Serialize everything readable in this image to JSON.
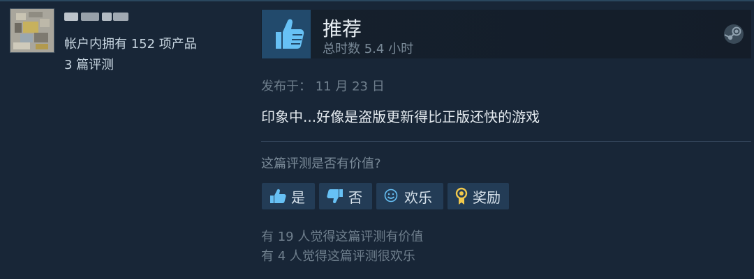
{
  "author": {
    "name_obscured": "",
    "products_owned": "帐户内拥有 152 项产品",
    "reviews_count": "3 篇评测"
  },
  "review": {
    "verdict": "推荐",
    "hours": "总时数 5.4 小时",
    "posted": "发布于：  11 月 23 日",
    "text": "印象中...好像是盗版更新得比正版还快的游戏",
    "helpful_question": "这篇评测是否有价值?",
    "buttons": {
      "yes": "是",
      "no": "否",
      "funny": "欢乐",
      "award": "奖励"
    },
    "stats": {
      "helpful": "有 19 人觉得这篇评测有价值",
      "funny": "有 4 人觉得这篇评测很欢乐"
    }
  },
  "icons": {
    "thumbs_up": "thumbs-up-icon",
    "thumbs_down": "thumbs-down-icon",
    "smile": "smile-icon",
    "award": "award-icon",
    "steam": "steam-logo-icon"
  },
  "colors": {
    "background": "#1b2838",
    "button_bg": "#233c56",
    "thumb_bg": "#224a6c",
    "accent_blue": "#66c0f4",
    "award_gold": "#f2c94c"
  }
}
